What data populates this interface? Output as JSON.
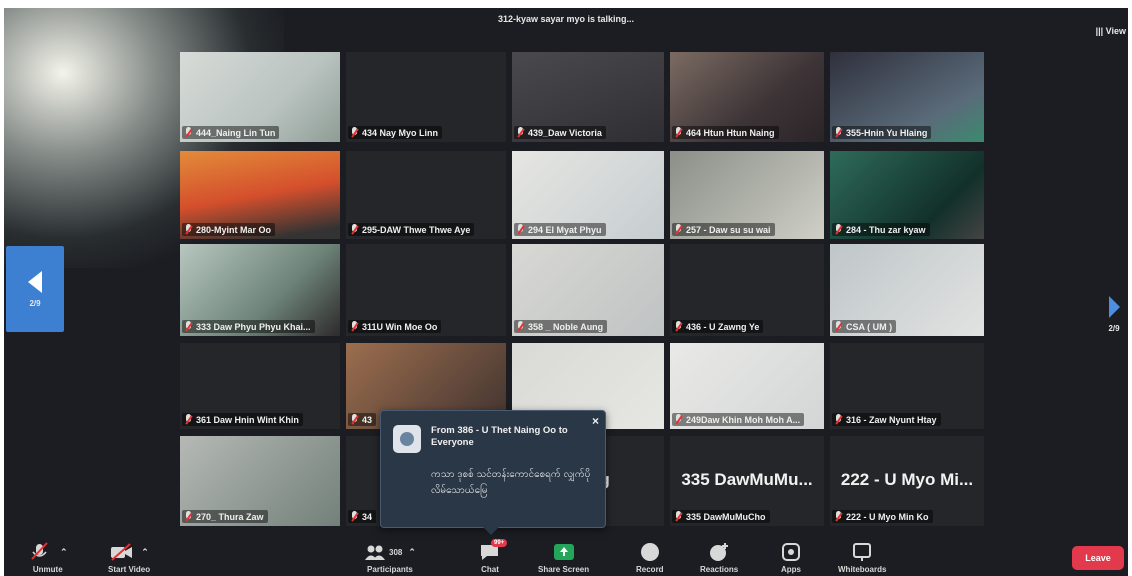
{
  "header": {
    "talking_status": "312-kyaw sayar myo is talking...",
    "view_button": "View"
  },
  "navigation": {
    "prev_page_label": "2/9",
    "next_page_label": "2/9"
  },
  "participants_grid": [
    {
      "name": "444_Naing Lin Tun",
      "video": true
    },
    {
      "name": "434 Nay Myo Linn",
      "video": false
    },
    {
      "name": "439_Daw Victoria",
      "video": true
    },
    {
      "name": "464 Htun Htun Naing",
      "video": true
    },
    {
      "name": "355-Hnin Yu Hlaing",
      "video": true
    },
    {
      "name": "280-Myint Mar Oo",
      "video": true
    },
    {
      "name": "295-DAW Thwe Thwe Aye",
      "video": false
    },
    {
      "name": "294 El Myat Phyu",
      "video": true
    },
    {
      "name": "257 - Daw su su wai",
      "video": true
    },
    {
      "name": "284 - Thu zar kyaw",
      "video": true
    },
    {
      "name": "333 Daw Phyu Phyu Khai...",
      "video": true
    },
    {
      "name": "311U Win Moe Oo",
      "video": false
    },
    {
      "name": "358 _ Noble Aung",
      "video": true
    },
    {
      "name": "436 - U Zawng Ye",
      "video": false
    },
    {
      "name": "CSA ( UM )",
      "video": true
    },
    {
      "name": "361 Daw Hnin Wint Khin",
      "video": false
    },
    {
      "name": "43",
      "video": true
    },
    {
      "name": "",
      "video": true
    },
    {
      "name": "249Daw Khin Moh Moh A...",
      "video": true
    },
    {
      "name": "316 - Zaw Nyunt Htay",
      "video": false
    },
    {
      "name": "270_ Thura Zaw",
      "video": true
    },
    {
      "name": "34",
      "video": false
    },
    {
      "name": "",
      "video": false
    },
    {
      "name": "335 DawMuMuCho",
      "video": false
    },
    {
      "name": "222 - U Myo Min Ko",
      "video": false
    }
  ],
  "big_names": {
    "tile_21": "34",
    "tile_22": "Aung",
    "tile_23": "335  DawMuMu...",
    "tile_24": "222 - U Myo Mi..."
  },
  "chat_popup": {
    "from": "From 386 - U Thet Naing Oo to Everyone",
    "message": "ကသာ ဒုစစ် သင်တန်းကောင်စေရက် လျှက်ပိုလိမ်သောယ်မြေ",
    "close": "×"
  },
  "toolbar": {
    "unmute": "Unmute",
    "start_video": "Start Video",
    "participants": "Participants",
    "participants_count": "308",
    "chat": "Chat",
    "chat_badge": "99+",
    "share_screen": "Share Screen",
    "record": "Record",
    "reactions": "Reactions",
    "apps": "Apps",
    "whiteboards": "Whiteboards",
    "leave": "Leave"
  },
  "colors": {
    "background": "#1b1d22",
    "tile": "#242629",
    "accent_blue": "#3d7fd1",
    "leave_red": "#e2394c",
    "share_green": "#23a55a",
    "mic_off_red": "#e8312f"
  }
}
